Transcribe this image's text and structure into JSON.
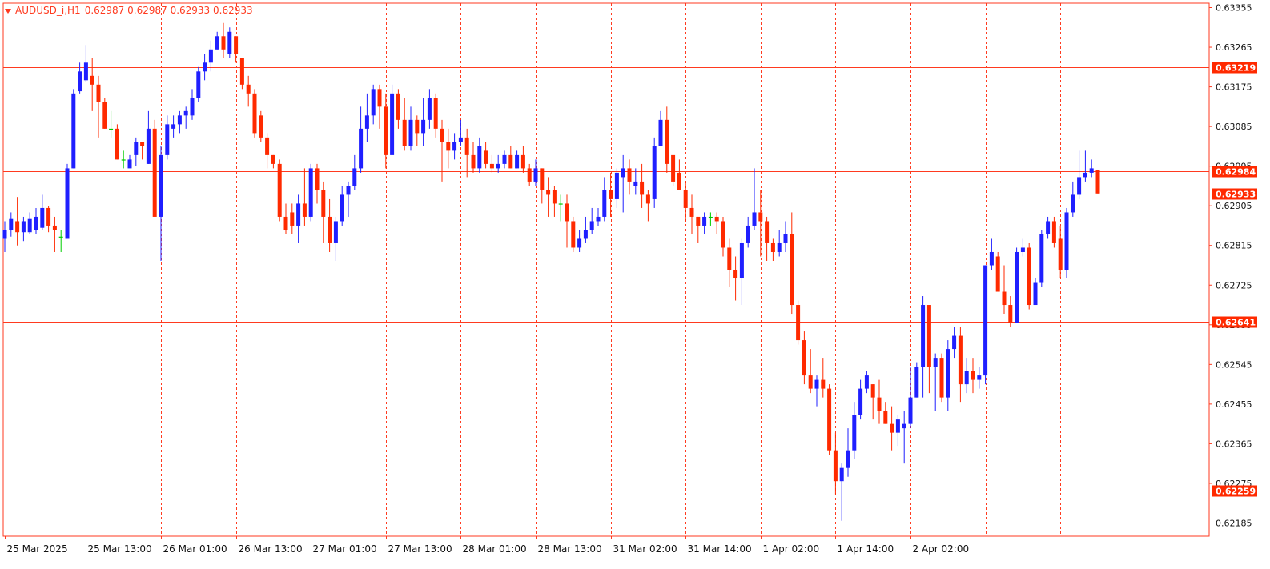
{
  "header": {
    "symbol": "AUDUSD_i,H1",
    "ohlc": "0.62987 0.62987 0.62933 0.62933"
  },
  "colors": {
    "bull": "#1f1fff",
    "bear": "#ff2a00",
    "axis": "#ff3a1f",
    "grid": "#ff3a1f",
    "label_text": "#ffffff",
    "doji": "#00cc00"
  },
  "chart_data": {
    "type": "candlestick",
    "timeframe": "H1",
    "ylim": [
      0.62155,
      0.63365
    ],
    "price_ticks": [
      "0.63355",
      "0.63265",
      "0.63175",
      "0.63085",
      "0.62995",
      "0.62905",
      "0.62815",
      "0.62725",
      "0.62635",
      "0.62545",
      "0.62455",
      "0.62365",
      "0.62275",
      "0.62185"
    ],
    "time_labels": [
      {
        "label": "25 Mar 2025",
        "index": 0
      },
      {
        "label": "25 Mar 13:00",
        "index": 13
      },
      {
        "label": "26 Mar 01:00",
        "index": 25
      },
      {
        "label": "26 Mar 13:00",
        "index": 37
      },
      {
        "label": "27 Mar 01:00",
        "index": 49
      },
      {
        "label": "27 Mar 13:00",
        "index": 61
      },
      {
        "label": "28 Mar 01:00",
        "index": 73
      },
      {
        "label": "28 Mar 13:00",
        "index": 85
      },
      {
        "label": "31 Mar 02:00",
        "index": 97
      },
      {
        "label": "31 Mar 14:00",
        "index": 109
      },
      {
        "label": "1 Apr 02:00",
        "index": 121
      },
      {
        "label": "1 Apr 14:00",
        "index": 133
      },
      {
        "label": "2 Apr 02:00",
        "index": 145
      }
    ],
    "grid": "vertical-dashed",
    "levels": [
      {
        "price": 0.63219,
        "label": "0.63219",
        "style": "line"
      },
      {
        "price": 0.62984,
        "label": "0.62984",
        "style": "line"
      },
      {
        "price": 0.62641,
        "label": "0.62641",
        "style": "line"
      },
      {
        "price": 0.62259,
        "label": "0.62259",
        "style": "line"
      },
      {
        "price": 0.62933,
        "label": "0.62933",
        "style": "bid"
      }
    ],
    "candles": [
      [
        0.6283,
        0.6285,
        0.628,
        0.6287
      ],
      [
        0.6285,
        0.62875,
        0.62835,
        0.6289
      ],
      [
        0.6287,
        0.62845,
        0.62815,
        0.62925
      ],
      [
        0.62845,
        0.6287,
        0.62825,
        0.6288
      ],
      [
        0.62845,
        0.62875,
        0.6284,
        0.6289
      ],
      [
        0.6285,
        0.6288,
        0.6284,
        0.629
      ],
      [
        0.62855,
        0.629,
        0.6285,
        0.6293
      ],
      [
        0.629,
        0.6286,
        0.62845,
        0.62905
      ],
      [
        0.6286,
        0.6285,
        0.628,
        0.6288
      ],
      [
        0.62835,
        0.62835,
        0.628,
        0.6285
      ],
      [
        0.6283,
        0.6299,
        0.6283,
        0.63
      ],
      [
        0.6299,
        0.6316,
        0.6299,
        0.6317
      ],
      [
        0.63165,
        0.6321,
        0.6316,
        0.6323
      ],
      [
        0.6319,
        0.6323,
        0.63185,
        0.6327
      ],
      [
        0.632,
        0.6318,
        0.6312,
        0.6324
      ],
      [
        0.6318,
        0.6314,
        0.6306,
        0.632
      ],
      [
        0.6314,
        0.6308,
        0.6308,
        0.6315
      ],
      [
        0.6308,
        0.6308,
        0.6306,
        0.6312
      ],
      [
        0.6308,
        0.6301,
        0.6301,
        0.6309
      ],
      [
        0.6301,
        0.6301,
        0.6299,
        0.6303
      ],
      [
        0.6299,
        0.6301,
        0.62995,
        0.6302
      ],
      [
        0.6302,
        0.6305,
        0.62995,
        0.6306
      ],
      [
        0.6305,
        0.6304,
        0.6301,
        0.6305
      ],
      [
        0.63,
        0.6308,
        0.63,
        0.6312
      ],
      [
        0.6308,
        0.6288,
        0.6288,
        0.631
      ],
      [
        0.6288,
        0.6302,
        0.6278,
        0.6304
      ],
      [
        0.6302,
        0.6309,
        0.6301,
        0.6311
      ],
      [
        0.6308,
        0.6309,
        0.6306,
        0.6311
      ],
      [
        0.6309,
        0.6311,
        0.6307,
        0.6312
      ],
      [
        0.6311,
        0.6312,
        0.6308,
        0.6313
      ],
      [
        0.6311,
        0.6315,
        0.631,
        0.6317
      ],
      [
        0.6315,
        0.6321,
        0.6314,
        0.6322
      ],
      [
        0.6321,
        0.6323,
        0.6319,
        0.6325
      ],
      [
        0.6323,
        0.6326,
        0.6321,
        0.6328
      ],
      [
        0.6326,
        0.6329,
        0.6326,
        0.633
      ],
      [
        0.6329,
        0.6326,
        0.6324,
        0.6332
      ],
      [
        0.6325,
        0.633,
        0.6324,
        0.6331
      ],
      [
        0.6329,
        0.6325,
        0.6323,
        0.6329
      ],
      [
        0.6324,
        0.6318,
        0.6317,
        0.6324
      ],
      [
        0.6318,
        0.6316,
        0.6313,
        0.632
      ],
      [
        0.6316,
        0.6307,
        0.6306,
        0.6317
      ],
      [
        0.6311,
        0.6306,
        0.6305,
        0.6312
      ],
      [
        0.6306,
        0.6302,
        0.6299,
        0.6307
      ],
      [
        0.6302,
        0.63,
        0.6299,
        0.6302
      ],
      [
        0.63,
        0.6288,
        0.6287,
        0.6301
      ],
      [
        0.6288,
        0.6285,
        0.6284,
        0.6291
      ],
      [
        0.6289,
        0.6286,
        0.6284,
        0.6291
      ],
      [
        0.6286,
        0.6291,
        0.6282,
        0.6293
      ],
      [
        0.6291,
        0.6288,
        0.6286,
        0.6299
      ],
      [
        0.6288,
        0.6299,
        0.6287,
        0.63
      ],
      [
        0.6299,
        0.6294,
        0.6291,
        0.63
      ],
      [
        0.6294,
        0.6288,
        0.6282,
        0.6296
      ],
      [
        0.6288,
        0.6282,
        0.628,
        0.6292
      ],
      [
        0.6282,
        0.6287,
        0.6278,
        0.6288
      ],
      [
        0.6287,
        0.6293,
        0.6286,
        0.6295
      ],
      [
        0.6293,
        0.6295,
        0.6288,
        0.6296
      ],
      [
        0.6295,
        0.6299,
        0.6294,
        0.6302
      ],
      [
        0.6299,
        0.6308,
        0.6298,
        0.6313
      ],
      [
        0.6308,
        0.6311,
        0.6305,
        0.6316
      ],
      [
        0.6311,
        0.6317,
        0.6309,
        0.6318
      ],
      [
        0.6317,
        0.6313,
        0.6308,
        0.6318
      ],
      [
        0.6313,
        0.6302,
        0.6299,
        0.6316
      ],
      [
        0.6302,
        0.6316,
        0.6302,
        0.6318
      ],
      [
        0.6316,
        0.631,
        0.6308,
        0.6317
      ],
      [
        0.631,
        0.6304,
        0.6303,
        0.6315
      ],
      [
        0.6304,
        0.631,
        0.6303,
        0.6313
      ],
      [
        0.631,
        0.6307,
        0.6304,
        0.6311
      ],
      [
        0.6307,
        0.631,
        0.6304,
        0.6315
      ],
      [
        0.631,
        0.6315,
        0.6308,
        0.6317
      ],
      [
        0.6315,
        0.6308,
        0.6306,
        0.6316
      ],
      [
        0.6308,
        0.6305,
        0.6296,
        0.631
      ],
      [
        0.6305,
        0.6303,
        0.6299,
        0.6308
      ],
      [
        0.6303,
        0.6305,
        0.6301,
        0.6307
      ],
      [
        0.6305,
        0.6306,
        0.6304,
        0.631
      ],
      [
        0.6306,
        0.6302,
        0.6297,
        0.6308
      ],
      [
        0.6302,
        0.6299,
        0.6298,
        0.6305
      ],
      [
        0.6299,
        0.6304,
        0.6298,
        0.6306
      ],
      [
        0.6303,
        0.63,
        0.6299,
        0.6305
      ],
      [
        0.63,
        0.6299,
        0.6298,
        0.6302
      ],
      [
        0.6299,
        0.63,
        0.6298,
        0.6302
      ],
      [
        0.63,
        0.6302,
        0.6299,
        0.6303
      ],
      [
        0.6302,
        0.6299,
        0.6299,
        0.6304
      ],
      [
        0.6299,
        0.6302,
        0.6299,
        0.6303
      ],
      [
        0.6302,
        0.6299,
        0.6298,
        0.6304
      ],
      [
        0.6299,
        0.6296,
        0.6295,
        0.63
      ],
      [
        0.6296,
        0.6299,
        0.6295,
        0.6301
      ],
      [
        0.6299,
        0.6294,
        0.6291,
        0.6299
      ],
      [
        0.6294,
        0.6293,
        0.6288,
        0.6297
      ],
      [
        0.6294,
        0.6291,
        0.6288,
        0.6295
      ],
      [
        0.6291,
        0.6291,
        0.6287,
        0.6293
      ],
      [
        0.6291,
        0.6287,
        0.6281,
        0.6293
      ],
      [
        0.6287,
        0.6281,
        0.628,
        0.6288
      ],
      [
        0.6281,
        0.6283,
        0.628,
        0.6285
      ],
      [
        0.6283,
        0.6285,
        0.6282,
        0.6288
      ],
      [
        0.6285,
        0.6287,
        0.6284,
        0.629
      ],
      [
        0.6287,
        0.6288,
        0.6286,
        0.629
      ],
      [
        0.6288,
        0.6294,
        0.6287,
        0.6297
      ],
      [
        0.6294,
        0.6292,
        0.6288,
        0.6298
      ],
      [
        0.6292,
        0.6298,
        0.629,
        0.6299
      ],
      [
        0.6297,
        0.6299,
        0.6289,
        0.6302
      ],
      [
        0.6299,
        0.6296,
        0.6293,
        0.6301
      ],
      [
        0.6295,
        0.6296,
        0.6293,
        0.6299
      ],
      [
        0.6296,
        0.6293,
        0.629,
        0.63
      ],
      [
        0.6293,
        0.6291,
        0.6287,
        0.6294
      ],
      [
        0.6292,
        0.6304,
        0.629,
        0.6306
      ],
      [
        0.6304,
        0.631,
        0.6304,
        0.6312
      ],
      [
        0.631,
        0.63,
        0.6298,
        0.6313
      ],
      [
        0.6302,
        0.6296,
        0.6295,
        0.63
      ],
      [
        0.6298,
        0.6294,
        0.6294,
        0.6301
      ],
      [
        0.6294,
        0.629,
        0.6287,
        0.6296
      ],
      [
        0.629,
        0.6288,
        0.6284,
        0.6293
      ],
      [
        0.6288,
        0.6286,
        0.6282,
        0.6288
      ],
      [
        0.6286,
        0.6288,
        0.6284,
        0.6289
      ],
      [
        0.6288,
        0.6288,
        0.6286,
        0.6289
      ],
      [
        0.6288,
        0.6287,
        0.6284,
        0.6289
      ],
      [
        0.6287,
        0.6281,
        0.6279,
        0.6288
      ],
      [
        0.6281,
        0.6276,
        0.6272,
        0.6283
      ],
      [
        0.6276,
        0.6274,
        0.6269,
        0.6279
      ],
      [
        0.6274,
        0.6282,
        0.6268,
        0.6283
      ],
      [
        0.6282,
        0.6286,
        0.6281,
        0.6288
      ],
      [
        0.6286,
        0.6289,
        0.6285,
        0.6299
      ],
      [
        0.6289,
        0.6287,
        0.6279,
        0.6294
      ],
      [
        0.6287,
        0.6282,
        0.6278,
        0.6288
      ],
      [
        0.6282,
        0.628,
        0.6278,
        0.6283
      ],
      [
        0.628,
        0.6282,
        0.6279,
        0.6285
      ],
      [
        0.6282,
        0.6284,
        0.628,
        0.6287
      ],
      [
        0.6284,
        0.6268,
        0.6266,
        0.6289
      ],
      [
        0.6268,
        0.626,
        0.6259,
        0.6269
      ],
      [
        0.626,
        0.6252,
        0.625,
        0.6262
      ],
      [
        0.6252,
        0.6249,
        0.6248,
        0.6258
      ],
      [
        0.6249,
        0.6251,
        0.6245,
        0.6252
      ],
      [
        0.6251,
        0.6249,
        0.6247,
        0.6256
      ],
      [
        0.6249,
        0.6235,
        0.6234,
        0.625
      ],
      [
        0.6235,
        0.6228,
        0.6225,
        0.6239
      ],
      [
        0.6228,
        0.6231,
        0.6219,
        0.6232
      ],
      [
        0.6231,
        0.6235,
        0.6229,
        0.624
      ],
      [
        0.6235,
        0.6243,
        0.6233,
        0.6246
      ],
      [
        0.6243,
        0.6249,
        0.6242,
        0.6251
      ],
      [
        0.6249,
        0.6252,
        0.6248,
        0.6253
      ],
      [
        0.625,
        0.6247,
        0.6242,
        0.625
      ],
      [
        0.6247,
        0.6244,
        0.6241,
        0.6251
      ],
      [
        0.6244,
        0.6241,
        0.6241,
        0.6246
      ],
      [
        0.6241,
        0.6239,
        0.6235,
        0.6245
      ],
      [
        0.6239,
        0.6242,
        0.6236,
        0.6243
      ],
      [
        0.624,
        0.6241,
        0.6232,
        0.6244
      ],
      [
        0.6241,
        0.6247,
        0.624,
        0.6254
      ],
      [
        0.6247,
        0.6254,
        0.6247,
        0.6255
      ],
      [
        0.6254,
        0.6268,
        0.6247,
        0.627
      ],
      [
        0.6268,
        0.6254,
        0.6248,
        0.6268
      ],
      [
        0.6254,
        0.6256,
        0.6244,
        0.6257
      ],
      [
        0.6256,
        0.6247,
        0.6246,
        0.6257
      ],
      [
        0.6247,
        0.6258,
        0.6244,
        0.626
      ],
      [
        0.6258,
        0.6261,
        0.6256,
        0.6263
      ],
      [
        0.6261,
        0.625,
        0.6246,
        0.6263
      ],
      [
        0.625,
        0.6253,
        0.6248,
        0.6256
      ],
      [
        0.6253,
        0.6251,
        0.6248,
        0.6256
      ],
      [
        0.6251,
        0.6252,
        0.6249,
        0.6254
      ],
      [
        0.6252,
        0.6277,
        0.625,
        0.6277
      ],
      [
        0.6277,
        0.628,
        0.6276,
        0.6283
      ],
      [
        0.6279,
        0.6271,
        0.6271,
        0.628
      ],
      [
        0.6271,
        0.6268,
        0.6266,
        0.6277
      ],
      [
        0.6268,
        0.6264,
        0.6263,
        0.627
      ],
      [
        0.6264,
        0.628,
        0.6264,
        0.6281
      ],
      [
        0.628,
        0.6281,
        0.6279,
        0.6283
      ],
      [
        0.6281,
        0.6268,
        0.6267,
        0.6282
      ],
      [
        0.6268,
        0.6273,
        0.6268,
        0.6274
      ],
      [
        0.6273,
        0.6284,
        0.6272,
        0.6285
      ],
      [
        0.6284,
        0.6287,
        0.6283,
        0.6288
      ],
      [
        0.6287,
        0.6282,
        0.6281,
        0.6288
      ],
      [
        0.6283,
        0.6276,
        0.6274,
        0.6286
      ],
      [
        0.6276,
        0.6289,
        0.6274,
        0.629
      ],
      [
        0.6289,
        0.6293,
        0.6288,
        0.6296
      ],
      [
        0.6293,
        0.6297,
        0.6292,
        0.6303
      ],
      [
        0.6297,
        0.6298,
        0.6296,
        0.6303
      ],
      [
        0.6298,
        0.6299,
        0.6297,
        0.6301
      ],
      [
        0.62987,
        0.62933,
        0.62933,
        0.62987
      ]
    ]
  }
}
